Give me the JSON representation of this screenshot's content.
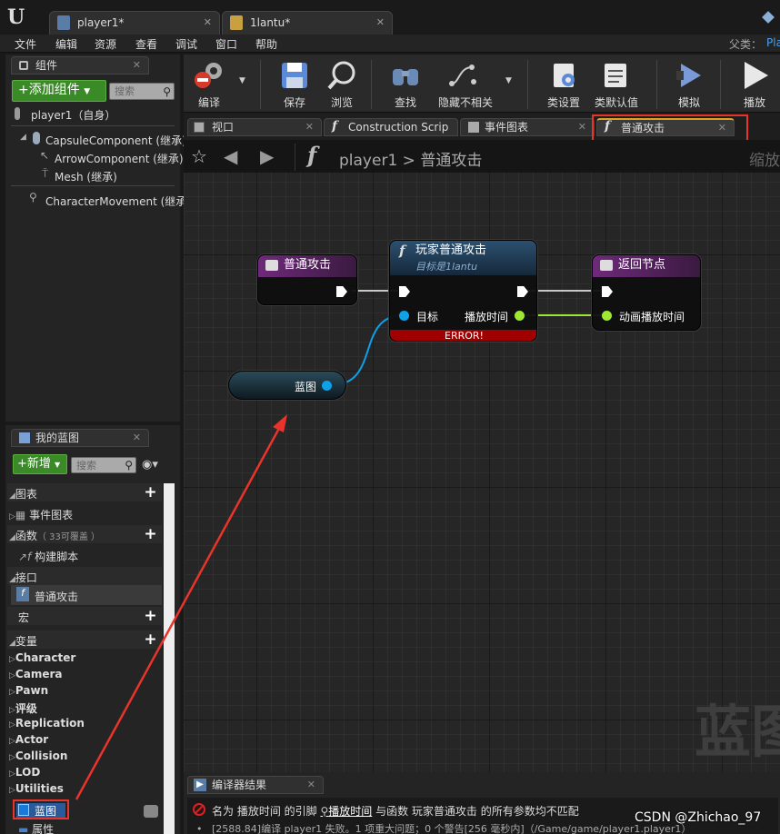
{
  "window": {
    "tabs": [
      {
        "label": "player1*"
      },
      {
        "label": "1lantu*"
      }
    ]
  },
  "menu": {
    "items": [
      "文件",
      "编辑",
      "资源",
      "查看",
      "调试",
      "窗口",
      "帮助"
    ],
    "parent_class_label": "父类：",
    "parent_class_value": "Pla"
  },
  "components_panel": {
    "tab_label": "组件",
    "add_button": "+添加组件",
    "search_placeholder": "搜索",
    "root": "player1（自身）",
    "items": [
      {
        "label": "CapsuleComponent (继承)"
      },
      {
        "label": "ArrowComponent (继承)"
      },
      {
        "label": "Mesh (继承)"
      },
      {
        "label": "CharacterMovement (继承)"
      }
    ]
  },
  "toolbar": {
    "buttons": [
      {
        "label": "编译",
        "icon": "compile-error-icon"
      },
      {
        "label": "保存",
        "icon": "save-icon"
      },
      {
        "label": "浏览",
        "icon": "browse-icon"
      },
      {
        "label": "查找",
        "icon": "binoculars-icon"
      },
      {
        "label": "隐藏不相关",
        "icon": "hide-unrelated-icon"
      },
      {
        "label": "类设置",
        "icon": "class-settings-icon"
      },
      {
        "label": "类默认值",
        "icon": "class-defaults-icon"
      },
      {
        "label": "模拟",
        "icon": "simulate-icon"
      },
      {
        "label": "播放",
        "icon": "play-icon"
      }
    ]
  },
  "editor_tabs": [
    {
      "label": "视口"
    },
    {
      "label": "Construction Scrip"
    },
    {
      "label": "事件图表"
    },
    {
      "label": "普通攻击"
    }
  ],
  "breadcrumb": {
    "root": "player1",
    "separator": ">",
    "current": "普通攻击",
    "zoom": "缩放"
  },
  "graph": {
    "entry_node": {
      "title": "普通攻击"
    },
    "call_node": {
      "title": "玩家普通攻击",
      "subtitle": "目标是1lantu",
      "pin_target": "目标",
      "pin_play_time": "播放时间",
      "error": "ERROR!"
    },
    "return_node": {
      "title": "返回节点",
      "pin_anim_time": "动画播放时间"
    },
    "variable_node": {
      "label": "蓝图"
    },
    "watermark": "蓝图"
  },
  "my_blueprint": {
    "tab_label": "我的蓝图",
    "new_button": "+新增",
    "search_placeholder": "搜索",
    "sections": {
      "graphs": "图表",
      "event_graph": "事件图表",
      "functions": "函数",
      "functions_count": "（ 33可覆盖 ）",
      "construction_script": "构建脚本",
      "interfaces": "接口",
      "interface_item": "普通攻击",
      "macros": "宏",
      "variables": "变量"
    },
    "variable_categories": [
      "Character",
      "Camera",
      "Pawn",
      "评级",
      "Replication",
      "Actor",
      "Collision",
      "LOD",
      "Utilities"
    ],
    "selected_variable": "蓝图",
    "next_item": "属性"
  },
  "compiler_results": {
    "tab_label": "编译器结果",
    "error_line_prefix": "名为 播放时间 的引脚",
    "error_link": "播放时间",
    "error_line_suffix": "与函数 玩家普通攻击 的所有参数均不匹配",
    "log_line": "[2588.84]编译 player1 失败。1 项重大问题；0 个警告[256 毫秒内]（/Game/game/player1.player1）"
  },
  "watermark_credit": "CSDN @Zhichao_97",
  "colors": {
    "exec_wire": "#c8c8c8",
    "object_pin": "#0fa0e8",
    "float_pin": "#9ee832",
    "entry_header": "#6e2a7a",
    "call_header": "#1f3e5a",
    "error_bar": "#a00000",
    "annotation_red": "#e8342a"
  }
}
